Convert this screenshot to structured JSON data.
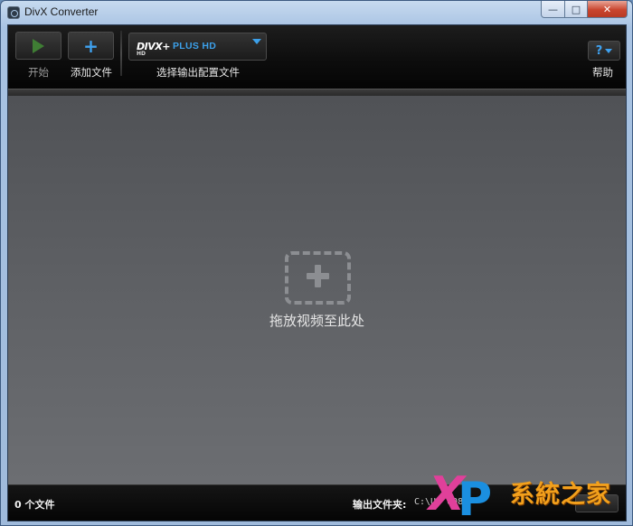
{
  "window": {
    "title": "DivX Converter",
    "controls": {
      "minimize": "—",
      "maximize": "□",
      "close": "✕"
    }
  },
  "toolbar": {
    "start_label": "开始",
    "add_file_label": "添加文件",
    "profile": {
      "logo": "DIVX+",
      "logo_sub": "HD",
      "selected": "PLUS HD",
      "label": "选择输出配置文件"
    },
    "help_label": "帮助",
    "help_glyph": "?"
  },
  "dropzone": {
    "text": "拖放视频至此处",
    "icon": "add-video-icon"
  },
  "footer": {
    "file_count": "0 个文件",
    "output_folder_label": "输出文件夹:",
    "output_path": "C:\\U- 008"
  },
  "watermark": {
    "x": "X",
    "p": "P",
    "text": "系統之家"
  },
  "colors": {
    "accent": "#3ca0ea",
    "play_green": "#3f7d34",
    "toolbar_bg": "#0c0c0c",
    "dropzone_bg": "#606266",
    "watermark_pink": "#e0409a",
    "watermark_blue": "#1b8fe0",
    "watermark_orange": "#f2a01c"
  }
}
